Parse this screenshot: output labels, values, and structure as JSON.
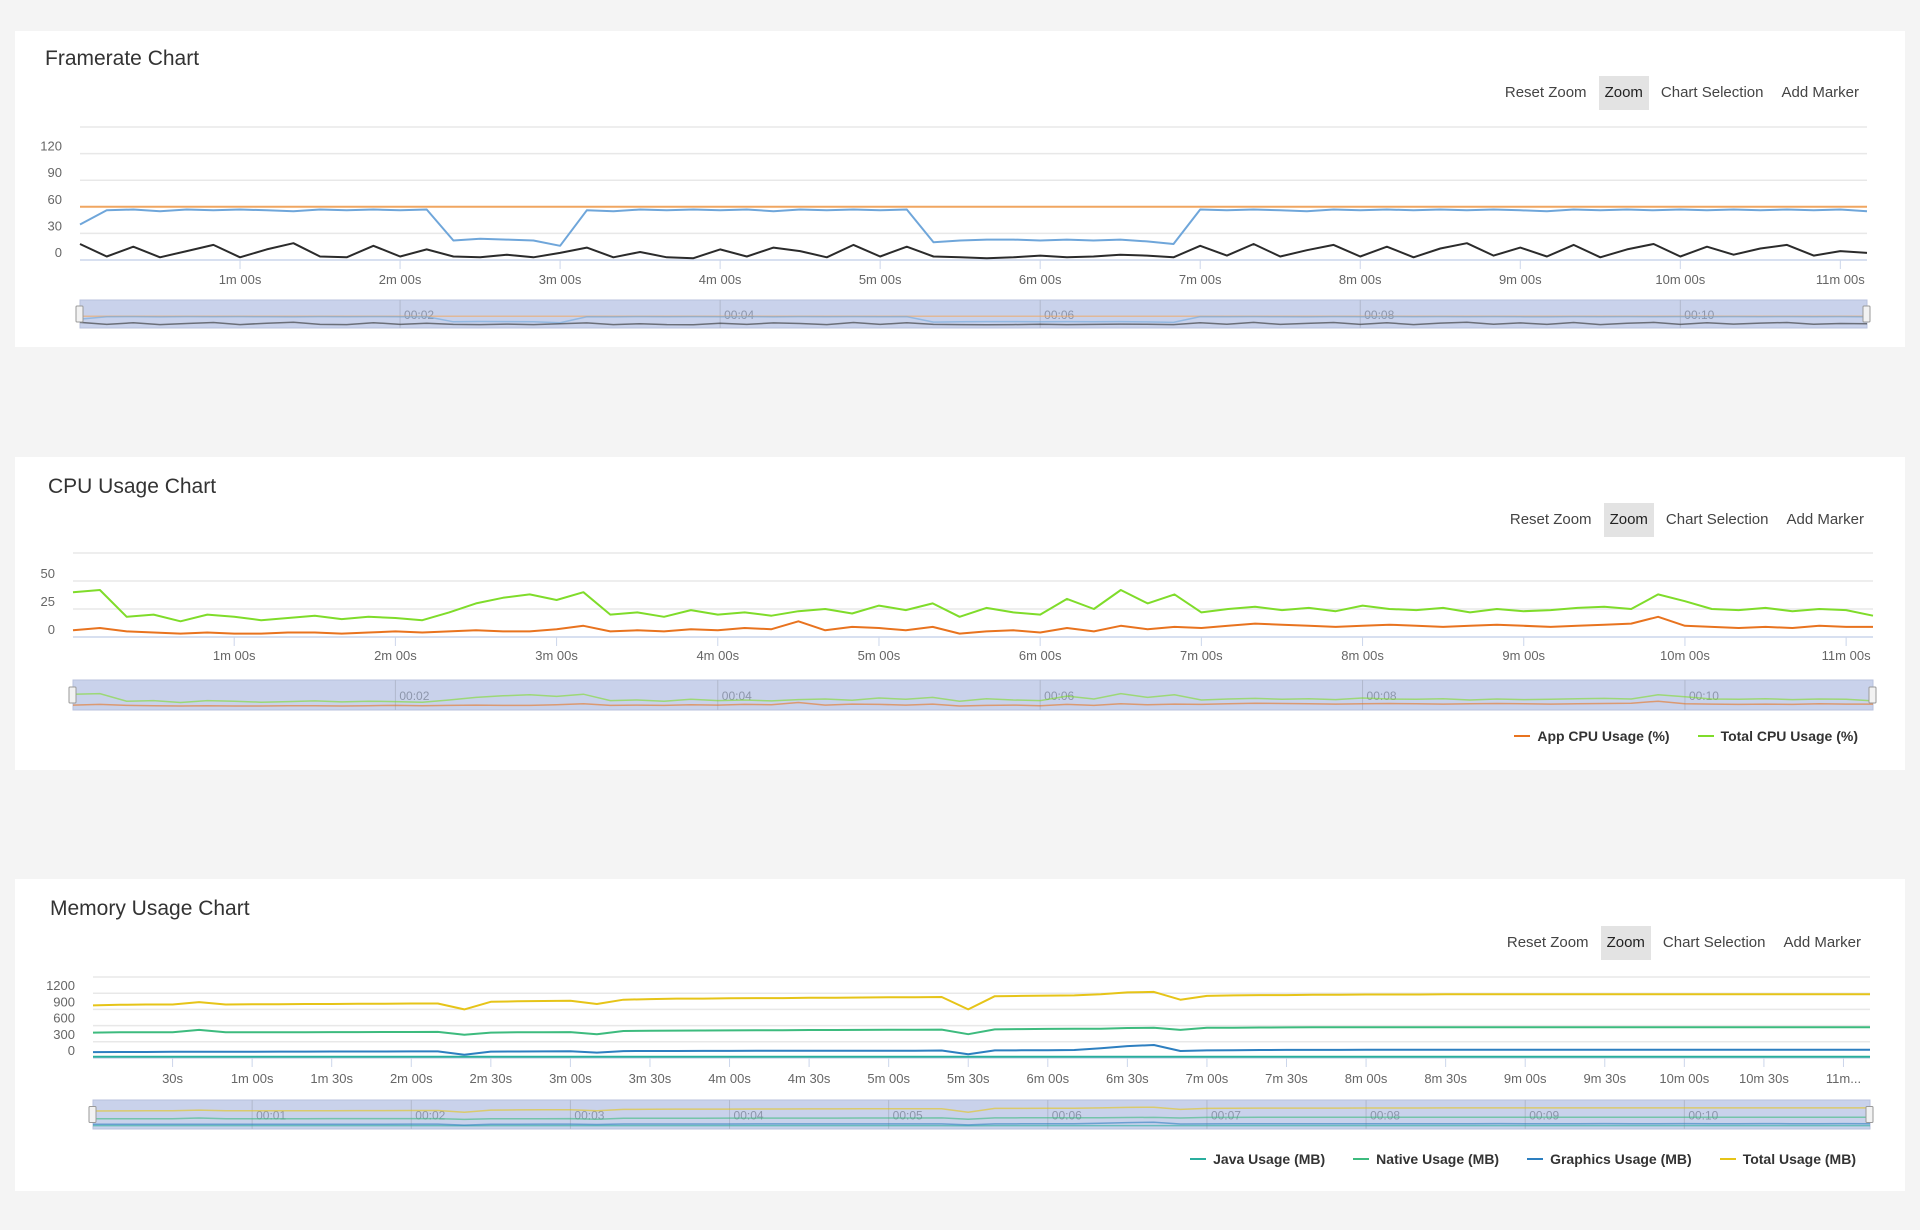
{
  "panels": [
    {
      "toolbar": {
        "reset_zoom": "Reset Zoom",
        "zoom": "Zoom",
        "chart_selection": "Chart Selection",
        "add_marker": "Add Marker",
        "active": "Zoom"
      }
    },
    {
      "toolbar": {
        "reset_zoom": "Reset Zoom",
        "zoom": "Zoom",
        "chart_selection": "Chart Selection",
        "add_marker": "Add Marker",
        "active": "Zoom"
      }
    },
    {
      "toolbar": {
        "reset_zoom": "Reset Zoom",
        "zoom": "Zoom",
        "chart_selection": "Chart Selection",
        "add_marker": "Add Marker",
        "active": "Zoom"
      }
    }
  ],
  "chart_data": [
    {
      "type": "line",
      "title": "Framerate Chart",
      "xlabel": "",
      "ylabel": "",
      "grid": true,
      "xlim": [
        0,
        670
      ],
      "ylim": [
        0,
        150
      ],
      "y_ticks": [
        0,
        30,
        60,
        90,
        120
      ],
      "x_ticks": [
        {
          "t": 60,
          "label": "1m 00s"
        },
        {
          "t": 120,
          "label": "2m 00s"
        },
        {
          "t": 180,
          "label": "3m 00s"
        },
        {
          "t": 240,
          "label": "4m 00s"
        },
        {
          "t": 300,
          "label": "5m 00s"
        },
        {
          "t": 360,
          "label": "6m 00s"
        },
        {
          "t": 420,
          "label": "7m 00s"
        },
        {
          "t": 480,
          "label": "8m 00s"
        },
        {
          "t": 540,
          "label": "9m 00s"
        },
        {
          "t": 600,
          "label": "10m 00s"
        },
        {
          "t": 660,
          "label": "11m 00s"
        }
      ],
      "navigator_labels": [
        {
          "t": 120,
          "label": "00:02"
        },
        {
          "t": 240,
          "label": "00:04"
        },
        {
          "t": 360,
          "label": "00:06"
        },
        {
          "t": 480,
          "label": "00:08"
        },
        {
          "t": 600,
          "label": "00:10"
        }
      ],
      "x": [
        0,
        10,
        20,
        30,
        40,
        50,
        60,
        70,
        80,
        90,
        100,
        110,
        120,
        130,
        140,
        150,
        160,
        170,
        180,
        190,
        200,
        210,
        220,
        230,
        240,
        250,
        260,
        270,
        280,
        290,
        300,
        310,
        320,
        330,
        340,
        350,
        360,
        370,
        380,
        390,
        400,
        410,
        420,
        430,
        440,
        450,
        460,
        470,
        480,
        490,
        500,
        510,
        520,
        530,
        540,
        550,
        560,
        570,
        580,
        590,
        600,
        610,
        620,
        630,
        640,
        650,
        660,
        670
      ],
      "series": [
        {
          "color": "#f0a660",
          "values": [
            60,
            60,
            60,
            60,
            60,
            60,
            60,
            60,
            60,
            60,
            60,
            60,
            60,
            60,
            60,
            60,
            60,
            60,
            60,
            60,
            60,
            60,
            60,
            60,
            60,
            60,
            60,
            60,
            60,
            60,
            60,
            60,
            60,
            60,
            60,
            60,
            60,
            60,
            60,
            60,
            60,
            60,
            60,
            60,
            60,
            60,
            60,
            60,
            60,
            60,
            60,
            60,
            60,
            60,
            60,
            60,
            60,
            60,
            60,
            60,
            60,
            60,
            60,
            60,
            60,
            60,
            60,
            60
          ]
        },
        {
          "color": "#6fa6da",
          "values": [
            40,
            56,
            57,
            55,
            57,
            56,
            57,
            56,
            55,
            57,
            56,
            57,
            56,
            57,
            22,
            24,
            23,
            22,
            16,
            56,
            55,
            57,
            56,
            57,
            56,
            57,
            55,
            57,
            56,
            57,
            56,
            57,
            20,
            22,
            23,
            23,
            22,
            23,
            22,
            23,
            21,
            18,
            57,
            56,
            57,
            56,
            55,
            57,
            56,
            57,
            56,
            57,
            56,
            57,
            56,
            55,
            57,
            56,
            57,
            56,
            57,
            56,
            57,
            56,
            57,
            56,
            57,
            55
          ]
        },
        {
          "color": "#2b2b2b",
          "values": [
            18,
            4,
            15,
            3,
            10,
            17,
            3,
            12,
            19,
            4,
            3,
            16,
            4,
            12,
            4,
            3,
            6,
            3,
            8,
            14,
            3,
            9,
            3,
            2,
            12,
            4,
            14,
            10,
            3,
            17,
            4,
            15,
            4,
            3,
            2,
            3,
            5,
            3,
            4,
            6,
            5,
            3,
            16,
            5,
            18,
            4,
            11,
            17,
            4,
            15,
            3,
            13,
            19,
            5,
            14,
            4,
            17,
            3,
            12,
            18,
            4,
            15,
            6,
            13,
            17,
            5,
            10,
            8
          ]
        }
      ]
    },
    {
      "type": "line",
      "title": "CPU Usage Chart",
      "xlabel": "",
      "ylabel": "",
      "grid": true,
      "legend": "bottom-right",
      "xlim": [
        0,
        670
      ],
      "ylim": [
        0,
        75
      ],
      "y_ticks": [
        0,
        25,
        50
      ],
      "x_ticks": [
        {
          "t": 60,
          "label": "1m 00s"
        },
        {
          "t": 120,
          "label": "2m 00s"
        },
        {
          "t": 180,
          "label": "3m 00s"
        },
        {
          "t": 240,
          "label": "4m 00s"
        },
        {
          "t": 300,
          "label": "5m 00s"
        },
        {
          "t": 360,
          "label": "6m 00s"
        },
        {
          "t": 420,
          "label": "7m 00s"
        },
        {
          "t": 480,
          "label": "8m 00s"
        },
        {
          "t": 540,
          "label": "9m 00s"
        },
        {
          "t": 600,
          "label": "10m 00s"
        },
        {
          "t": 660,
          "label": "11m 00s"
        }
      ],
      "navigator_labels": [
        {
          "t": 120,
          "label": "00:02"
        },
        {
          "t": 240,
          "label": "00:04"
        },
        {
          "t": 360,
          "label": "00:06"
        },
        {
          "t": 480,
          "label": "00:08"
        },
        {
          "t": 600,
          "label": "00:10"
        }
      ],
      "x": [
        0,
        10,
        20,
        30,
        40,
        50,
        60,
        70,
        80,
        90,
        100,
        110,
        120,
        130,
        140,
        150,
        160,
        170,
        180,
        190,
        200,
        210,
        220,
        230,
        240,
        250,
        260,
        270,
        280,
        290,
        300,
        310,
        320,
        330,
        340,
        350,
        360,
        370,
        380,
        390,
        400,
        410,
        420,
        430,
        440,
        450,
        460,
        470,
        480,
        490,
        500,
        510,
        520,
        530,
        540,
        550,
        560,
        570,
        580,
        590,
        600,
        610,
        620,
        630,
        640,
        650,
        660,
        670
      ],
      "series": [
        {
          "name": "App CPU Usage (%)",
          "color": "#e8731f",
          "values": [
            6,
            8,
            5,
            4,
            3,
            4,
            3,
            3,
            4,
            4,
            3,
            4,
            5,
            4,
            5,
            6,
            5,
            5,
            7,
            10,
            5,
            6,
            5,
            7,
            6,
            8,
            7,
            14,
            6,
            9,
            8,
            6,
            9,
            3,
            5,
            6,
            4,
            8,
            5,
            10,
            7,
            9,
            8,
            10,
            12,
            11,
            10,
            9,
            10,
            11,
            10,
            9,
            10,
            11,
            10,
            9,
            10,
            11,
            12,
            18,
            10,
            9,
            8,
            9,
            8,
            10,
            9,
            9
          ]
        },
        {
          "name": "Total CPU Usage (%)",
          "color": "#7fdc2a",
          "values": [
            40,
            42,
            18,
            20,
            14,
            20,
            18,
            15,
            17,
            19,
            16,
            18,
            17,
            15,
            22,
            30,
            35,
            38,
            33,
            40,
            20,
            22,
            18,
            24,
            20,
            22,
            19,
            23,
            25,
            21,
            28,
            24,
            30,
            18,
            26,
            22,
            20,
            34,
            25,
            42,
            30,
            38,
            22,
            25,
            27,
            24,
            26,
            23,
            28,
            25,
            24,
            26,
            22,
            25,
            23,
            24,
            26,
            27,
            25,
            38,
            32,
            25,
            24,
            26,
            23,
            25,
            24,
            19
          ]
        }
      ]
    },
    {
      "type": "line",
      "title": "Memory Usage Chart",
      "xlabel": "",
      "ylabel": "",
      "grid": true,
      "legend": "bottom-right",
      "xlim": [
        0,
        670
      ],
      "ylim": [
        0,
        1500
      ],
      "y_ticks": [
        0,
        300,
        600,
        900,
        1200
      ],
      "x_ticks": [
        {
          "t": 30,
          "label": "30s"
        },
        {
          "t": 60,
          "label": "1m 00s"
        },
        {
          "t": 90,
          "label": "1m 30s"
        },
        {
          "t": 120,
          "label": "2m 00s"
        },
        {
          "t": 150,
          "label": "2m 30s"
        },
        {
          "t": 180,
          "label": "3m 00s"
        },
        {
          "t": 210,
          "label": "3m 30s"
        },
        {
          "t": 240,
          "label": "4m 00s"
        },
        {
          "t": 270,
          "label": "4m 30s"
        },
        {
          "t": 300,
          "label": "5m 00s"
        },
        {
          "t": 330,
          "label": "5m 30s"
        },
        {
          "t": 360,
          "label": "6m 00s"
        },
        {
          "t": 390,
          "label": "6m 30s"
        },
        {
          "t": 420,
          "label": "7m 00s"
        },
        {
          "t": 450,
          "label": "7m 30s"
        },
        {
          "t": 480,
          "label": "8m 00s"
        },
        {
          "t": 510,
          "label": "8m 30s"
        },
        {
          "t": 540,
          "label": "9m 00s"
        },
        {
          "t": 570,
          "label": "9m 30s"
        },
        {
          "t": 600,
          "label": "10m 00s"
        },
        {
          "t": 630,
          "label": "10m 30s"
        },
        {
          "t": 660,
          "label": "11m..."
        }
      ],
      "navigator_labels": [
        {
          "t": 60,
          "label": "00:01"
        },
        {
          "t": 120,
          "label": "00:02"
        },
        {
          "t": 180,
          "label": "00:03"
        },
        {
          "t": 240,
          "label": "00:04"
        },
        {
          "t": 300,
          "label": "00:05"
        },
        {
          "t": 360,
          "label": "00:06"
        },
        {
          "t": 420,
          "label": "00:07"
        },
        {
          "t": 480,
          "label": "00:08"
        },
        {
          "t": 540,
          "label": "00:09"
        },
        {
          "t": 600,
          "label": "00:10"
        }
      ],
      "x": [
        0,
        10,
        20,
        30,
        40,
        50,
        60,
        70,
        80,
        90,
        100,
        110,
        120,
        130,
        140,
        150,
        160,
        170,
        180,
        190,
        200,
        210,
        220,
        230,
        240,
        250,
        260,
        270,
        280,
        290,
        300,
        310,
        320,
        330,
        340,
        350,
        360,
        370,
        380,
        390,
        400,
        410,
        420,
        430,
        440,
        450,
        460,
        470,
        480,
        490,
        500,
        510,
        520,
        530,
        540,
        550,
        560,
        570,
        580,
        590,
        600,
        610,
        620,
        630,
        640,
        650,
        660,
        670
      ],
      "series": [
        {
          "name": "Java Usage (MB)",
          "color": "#2aae9e",
          "values": [
            25,
            25,
            25,
            25,
            25,
            25,
            25,
            25,
            25,
            25,
            25,
            25,
            25,
            25,
            22,
            25,
            25,
            25,
            25,
            24,
            25,
            25,
            25,
            25,
            25,
            25,
            25,
            25,
            25,
            25,
            25,
            25,
            25,
            22,
            25,
            25,
            25,
            25,
            25,
            25,
            25,
            24,
            25,
            25,
            25,
            25,
            25,
            25,
            25,
            25,
            25,
            25,
            25,
            25,
            25,
            25,
            25,
            25,
            25,
            25,
            25,
            25,
            25,
            25,
            25,
            25,
            25,
            25
          ]
        },
        {
          "name": "Native Usage (MB)",
          "color": "#3dbb7e",
          "values": [
            470,
            475,
            475,
            475,
            520,
            475,
            475,
            478,
            478,
            480,
            480,
            482,
            482,
            484,
            430,
            470,
            475,
            478,
            480,
            440,
            500,
            505,
            508,
            510,
            512,
            515,
            515,
            518,
            518,
            520,
            522,
            524,
            526,
            440,
            530,
            535,
            538,
            540,
            542,
            555,
            560,
            520,
            560,
            562,
            565,
            566,
            568,
            568,
            570,
            570,
            570,
            570,
            570,
            570,
            570,
            570,
            570,
            570,
            570,
            570,
            570,
            570,
            570,
            570,
            570,
            570,
            570,
            570
          ]
        },
        {
          "name": "Graphics Usage (MB)",
          "color": "#2d7fc0",
          "values": [
            110,
            112,
            112,
            114,
            114,
            116,
            116,
            118,
            118,
            120,
            120,
            120,
            122,
            122,
            60,
            118,
            120,
            122,
            124,
            100,
            128,
            130,
            130,
            132,
            132,
            134,
            134,
            135,
            135,
            136,
            136,
            136,
            138,
            70,
            140,
            142,
            145,
            148,
            180,
            220,
            240,
            130,
            140,
            145,
            148,
            150,
            150,
            150,
            152,
            152,
            152,
            153,
            152,
            154,
            152,
            153,
            152,
            154,
            153,
            152,
            154,
            153,
            152,
            154,
            153,
            152,
            154,
            152
          ]
        },
        {
          "name": "Total Usage (MB)",
          "color": "#e6c418",
          "values": [
            975,
            985,
            990,
            990,
            1035,
            990,
            995,
            995,
            1000,
            1000,
            1005,
            1005,
            1010,
            1010,
            900,
            1040,
            1050,
            1055,
            1060,
            1000,
            1080,
            1090,
            1100,
            1100,
            1105,
            1110,
            1110,
            1115,
            1115,
            1120,
            1125,
            1125,
            1130,
            900,
            1145,
            1150,
            1155,
            1160,
            1180,
            1215,
            1225,
            1080,
            1150,
            1160,
            1165,
            1165,
            1170,
            1170,
            1175,
            1175,
            1175,
            1180,
            1180,
            1180,
            1180,
            1180,
            1180,
            1180,
            1180,
            1180,
            1180,
            1180,
            1180,
            1180,
            1180,
            1180,
            1180,
            1180
          ]
        }
      ]
    }
  ]
}
